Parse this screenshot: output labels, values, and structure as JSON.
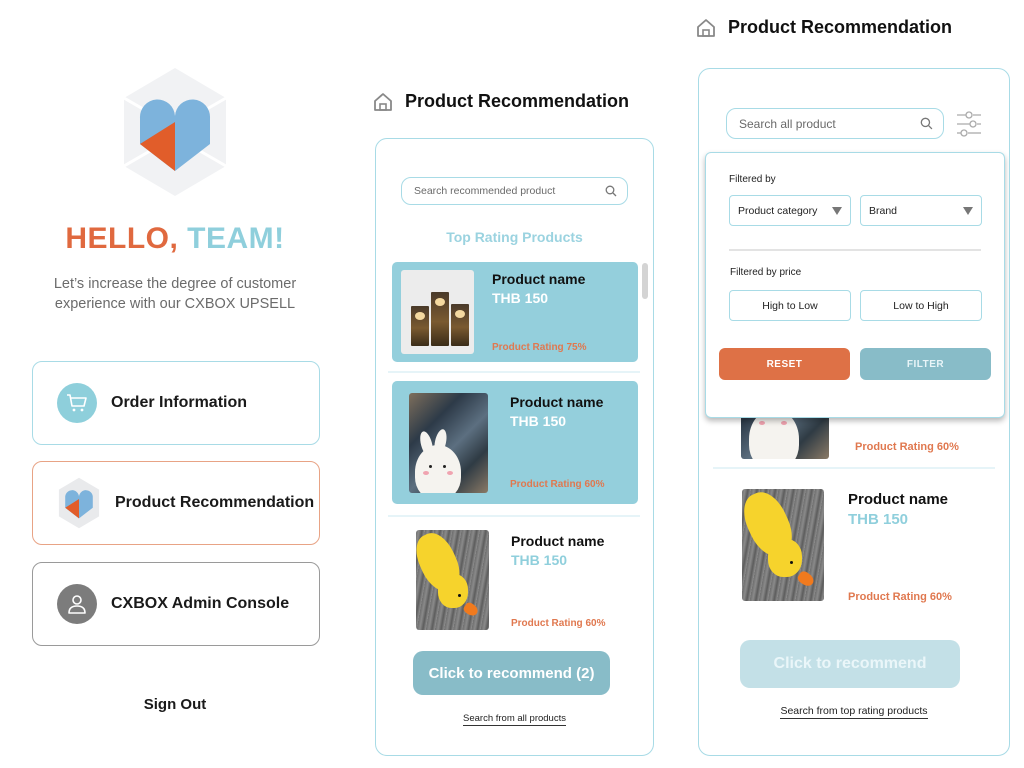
{
  "colors": {
    "accent_orange": "#e0693f",
    "accent_blue": "#8fcfdc",
    "selected_card": "#94cfdc",
    "cta_blue": "#88bcc8",
    "reset_orange": "#de7146"
  },
  "home": {
    "greeting_part1": "HELLO,",
    "greeting_part2": "TEAM!",
    "subtitle_line1": "Let’s increase the degree of customer",
    "subtitle_line2": "experience with our CXBOX UPSELL",
    "menu": [
      {
        "label": "Order Information",
        "icon": "cart-icon"
      },
      {
        "label": "Product Recommendation",
        "icon": "cxbox-logo-icon"
      },
      {
        "label": "CXBOX Admin Console",
        "icon": "user-icon"
      }
    ],
    "sign_out": "Sign Out"
  },
  "recommend_screen": {
    "title": "Product Recommendation",
    "search_placeholder": "Search recommended product",
    "section_title": "Top Rating Products",
    "products": [
      {
        "name": "Product name",
        "price": "THB 150",
        "rating": "Product Rating 75%",
        "selected": true,
        "image": "candles"
      },
      {
        "name": "Product name",
        "price": "THB 150",
        "rating": "Product Rating 60%",
        "selected": true,
        "image": "bunny"
      },
      {
        "name": "Product name",
        "price": "THB 150",
        "rating": "Product Rating 60%",
        "selected": false,
        "image": "duck"
      }
    ],
    "cta_label": "Click to recommend (2)",
    "link_label": "Search from all products"
  },
  "filter_screen": {
    "title": "Product Recommendation",
    "search_placeholder": "Search all product",
    "filter": {
      "filtered_by_label": "Filtered by",
      "category_select": "Product category",
      "brand_select": "Brand",
      "price_label": "Filtered by price",
      "high_to_low": "High to Low",
      "low_to_high": "Low to High",
      "reset": "RESET",
      "apply": "FILTER"
    },
    "products": [
      {
        "rating": "Product Rating 60%",
        "image": "bunny"
      },
      {
        "name": "Product name",
        "price": "THB 150",
        "rating": "Product Rating 60%",
        "image": "duck"
      }
    ],
    "cta_label": "Click to recommend",
    "link_label": "Search from top rating products"
  }
}
